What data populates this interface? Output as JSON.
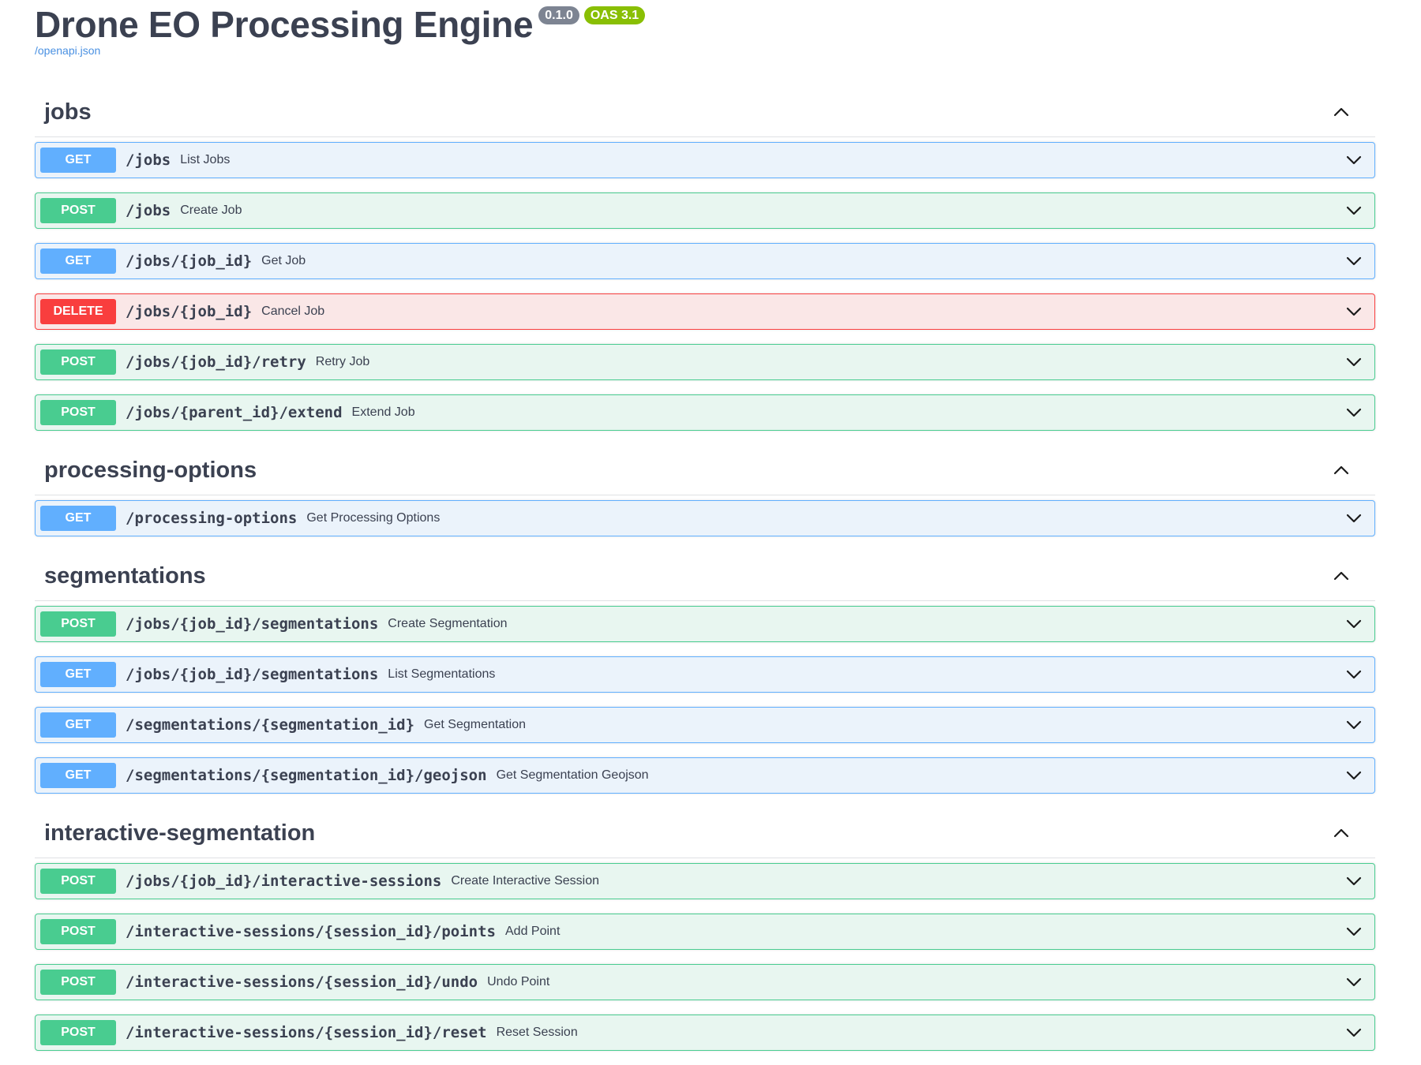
{
  "info": {
    "title": "Drone EO Processing Engine",
    "version": "0.1.0",
    "oas": "OAS 3.1",
    "spec_link": "/openapi.json"
  },
  "icons": {
    "collapse": "chevron-up-icon",
    "expand": "chevron-down-icon"
  },
  "colors": {
    "get": "#61affe",
    "post": "#49cc90",
    "delete": "#f93e3e"
  },
  "tags": [
    {
      "name": "jobs",
      "ops": [
        {
          "method": "GET",
          "path": "/jobs",
          "summary": "List Jobs"
        },
        {
          "method": "POST",
          "path": "/jobs",
          "summary": "Create Job"
        },
        {
          "method": "GET",
          "path": "/jobs/{job_id}",
          "summary": "Get Job"
        },
        {
          "method": "DELETE",
          "path": "/jobs/{job_id}",
          "summary": "Cancel Job"
        },
        {
          "method": "POST",
          "path": "/jobs/{job_id}/retry",
          "summary": "Retry Job"
        },
        {
          "method": "POST",
          "path": "/jobs/{parent_id}/extend",
          "summary": "Extend Job"
        }
      ]
    },
    {
      "name": "processing-options",
      "ops": [
        {
          "method": "GET",
          "path": "/processing-options",
          "summary": "Get Processing Options"
        }
      ]
    },
    {
      "name": "segmentations",
      "ops": [
        {
          "method": "POST",
          "path": "/jobs/{job_id}/segmentations",
          "summary": "Create Segmentation"
        },
        {
          "method": "GET",
          "path": "/jobs/{job_id}/segmentations",
          "summary": "List Segmentations"
        },
        {
          "method": "GET",
          "path": "/segmentations/{segmentation_id}",
          "summary": "Get Segmentation"
        },
        {
          "method": "GET",
          "path": "/segmentations/{segmentation_id}/geojson",
          "summary": "Get Segmentation Geojson"
        }
      ]
    },
    {
      "name": "interactive-segmentation",
      "ops": [
        {
          "method": "POST",
          "path": "/jobs/{job_id}/interactive-sessions",
          "summary": "Create Interactive Session"
        },
        {
          "method": "POST",
          "path": "/interactive-sessions/{session_id}/points",
          "summary": "Add Point"
        },
        {
          "method": "POST",
          "path": "/interactive-sessions/{session_id}/undo",
          "summary": "Undo Point"
        },
        {
          "method": "POST",
          "path": "/interactive-sessions/{session_id}/reset",
          "summary": "Reset Session"
        }
      ]
    }
  ]
}
